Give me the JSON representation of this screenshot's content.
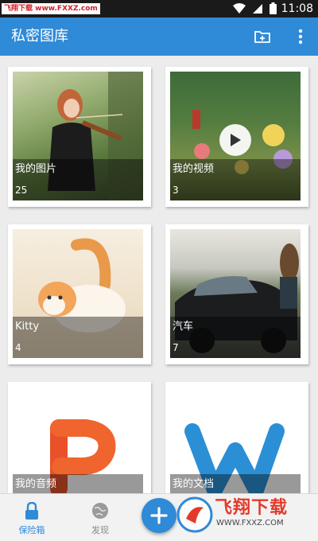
{
  "status_bar": {
    "watermark_text": "飞翔下载 www.FXXZ.com",
    "time": "11:08"
  },
  "app_bar": {
    "title": "私密图库",
    "actions": [
      "new-folder-icon",
      "more-vert-icon"
    ]
  },
  "albums": [
    {
      "name": "我的图片",
      "count": "25",
      "kind": "photo",
      "subject": "woman playing violin"
    },
    {
      "name": "我的视频",
      "count": "3",
      "kind": "video",
      "subject": "garden with flowers"
    },
    {
      "name": "Kitty",
      "count": "4",
      "kind": "photo",
      "subject": "orange and white kitten"
    },
    {
      "name": "汽车",
      "count": "7",
      "kind": "photo",
      "subject": "classic black car"
    },
    {
      "name": "我的音频",
      "count": "",
      "kind": "audio",
      "subject": "orange P logo"
    },
    {
      "name": "我的文档",
      "count": "",
      "kind": "document",
      "subject": "blue W logo"
    }
  ],
  "bottom_nav": {
    "tabs": [
      {
        "label": "保险箱",
        "icon": "lock-icon",
        "active": true
      },
      {
        "label": "发现",
        "icon": "globe-icon",
        "active": false
      }
    ],
    "fab_icon": "plus-icon"
  },
  "watermark": {
    "brand": "飞翔下载",
    "url": "WWW.FXXZ.COM"
  },
  "colors": {
    "primary": "#2f8ad8",
    "status_bar": "#1a1a1a",
    "background": "#ececec",
    "active_tab": "#2f8ad8",
    "inactive_tab": "#8a8a8a",
    "audio_logo": "#e8512a",
    "document_logo": "#2b8fd6"
  }
}
